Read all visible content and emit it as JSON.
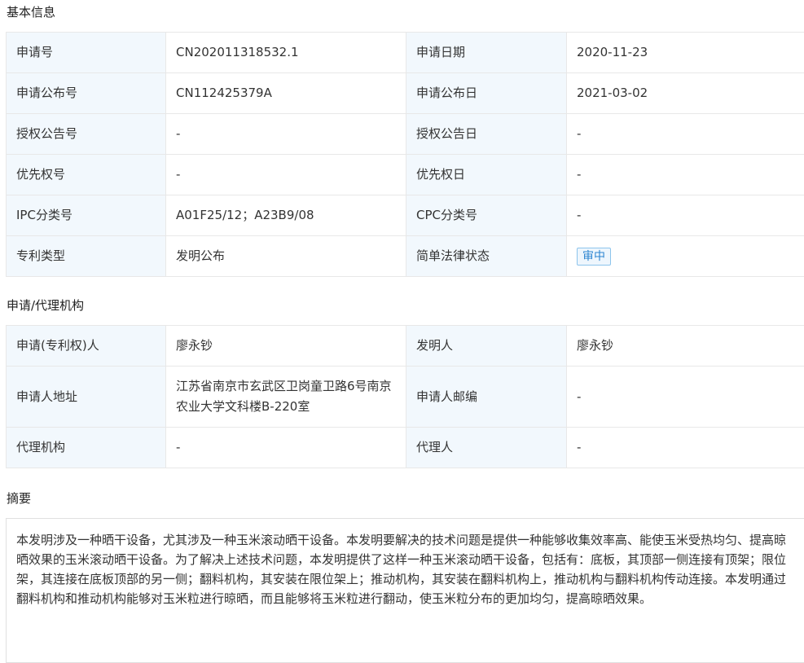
{
  "basic": {
    "title": "基本信息",
    "rows": [
      {
        "l1": "申请号",
        "v1": "CN202011318532.1",
        "l2": "申请日期",
        "v2": "2020-11-23"
      },
      {
        "l1": "申请公布号",
        "v1": "CN112425379A",
        "l2": "申请公布日",
        "v2": "2021-03-02"
      },
      {
        "l1": "授权公告号",
        "v1": "-",
        "l2": "授权公告日",
        "v2": "-"
      },
      {
        "l1": "优先权号",
        "v1": "-",
        "l2": "优先权日",
        "v2": "-"
      },
      {
        "l1": "IPC分类号",
        "v1": "A01F25/12；A23B9/08",
        "l2": "CPC分类号",
        "v2": "-"
      },
      {
        "l1": "专利类型",
        "v1": "发明公布",
        "l2": "简单法律状态",
        "v2": "审中"
      }
    ]
  },
  "agency": {
    "title": "申请/代理机构",
    "rows": [
      {
        "l1": "申请(专利权)人",
        "v1": "廖永钞",
        "l2": "发明人",
        "v2": "廖永钞"
      },
      {
        "l1": "申请人地址",
        "v1": "江苏省南京市玄武区卫岗童卫路6号南京农业大学文科楼B-220室",
        "l2": "申请人邮编",
        "v2": "-"
      },
      {
        "l1": "代理机构",
        "v1": "-",
        "l2": "代理人",
        "v2": "-"
      }
    ]
  },
  "abstract": {
    "title": "摘要",
    "text": "本发明涉及一种晒干设备，尤其涉及一种玉米滚动晒干设备。本发明要解决的技术问题是提供一种能够收集效率高、能使玉米受热均匀、提高晾晒效果的玉米滚动晒干设备。为了解决上述技术问题，本发明提供了这样一种玉米滚动晒干设备，包括有：底板，其顶部一侧连接有顶架；限位架，其连接在底板顶部的另一侧；翻料机构，其安装在限位架上；推动机构，其安装在翻料机构上，推动机构与翻料机构传动连接。本发明通过翻料机构和推动机构能够对玉米粒进行晾晒，而且能够将玉米粒进行翻动，使玉米粒分布的更加均匀，提高晾晒效果。"
  },
  "colors": {
    "label_bg": "#f2f8fd",
    "border": "#e8e8e8",
    "badge": "#2d86d1"
  }
}
